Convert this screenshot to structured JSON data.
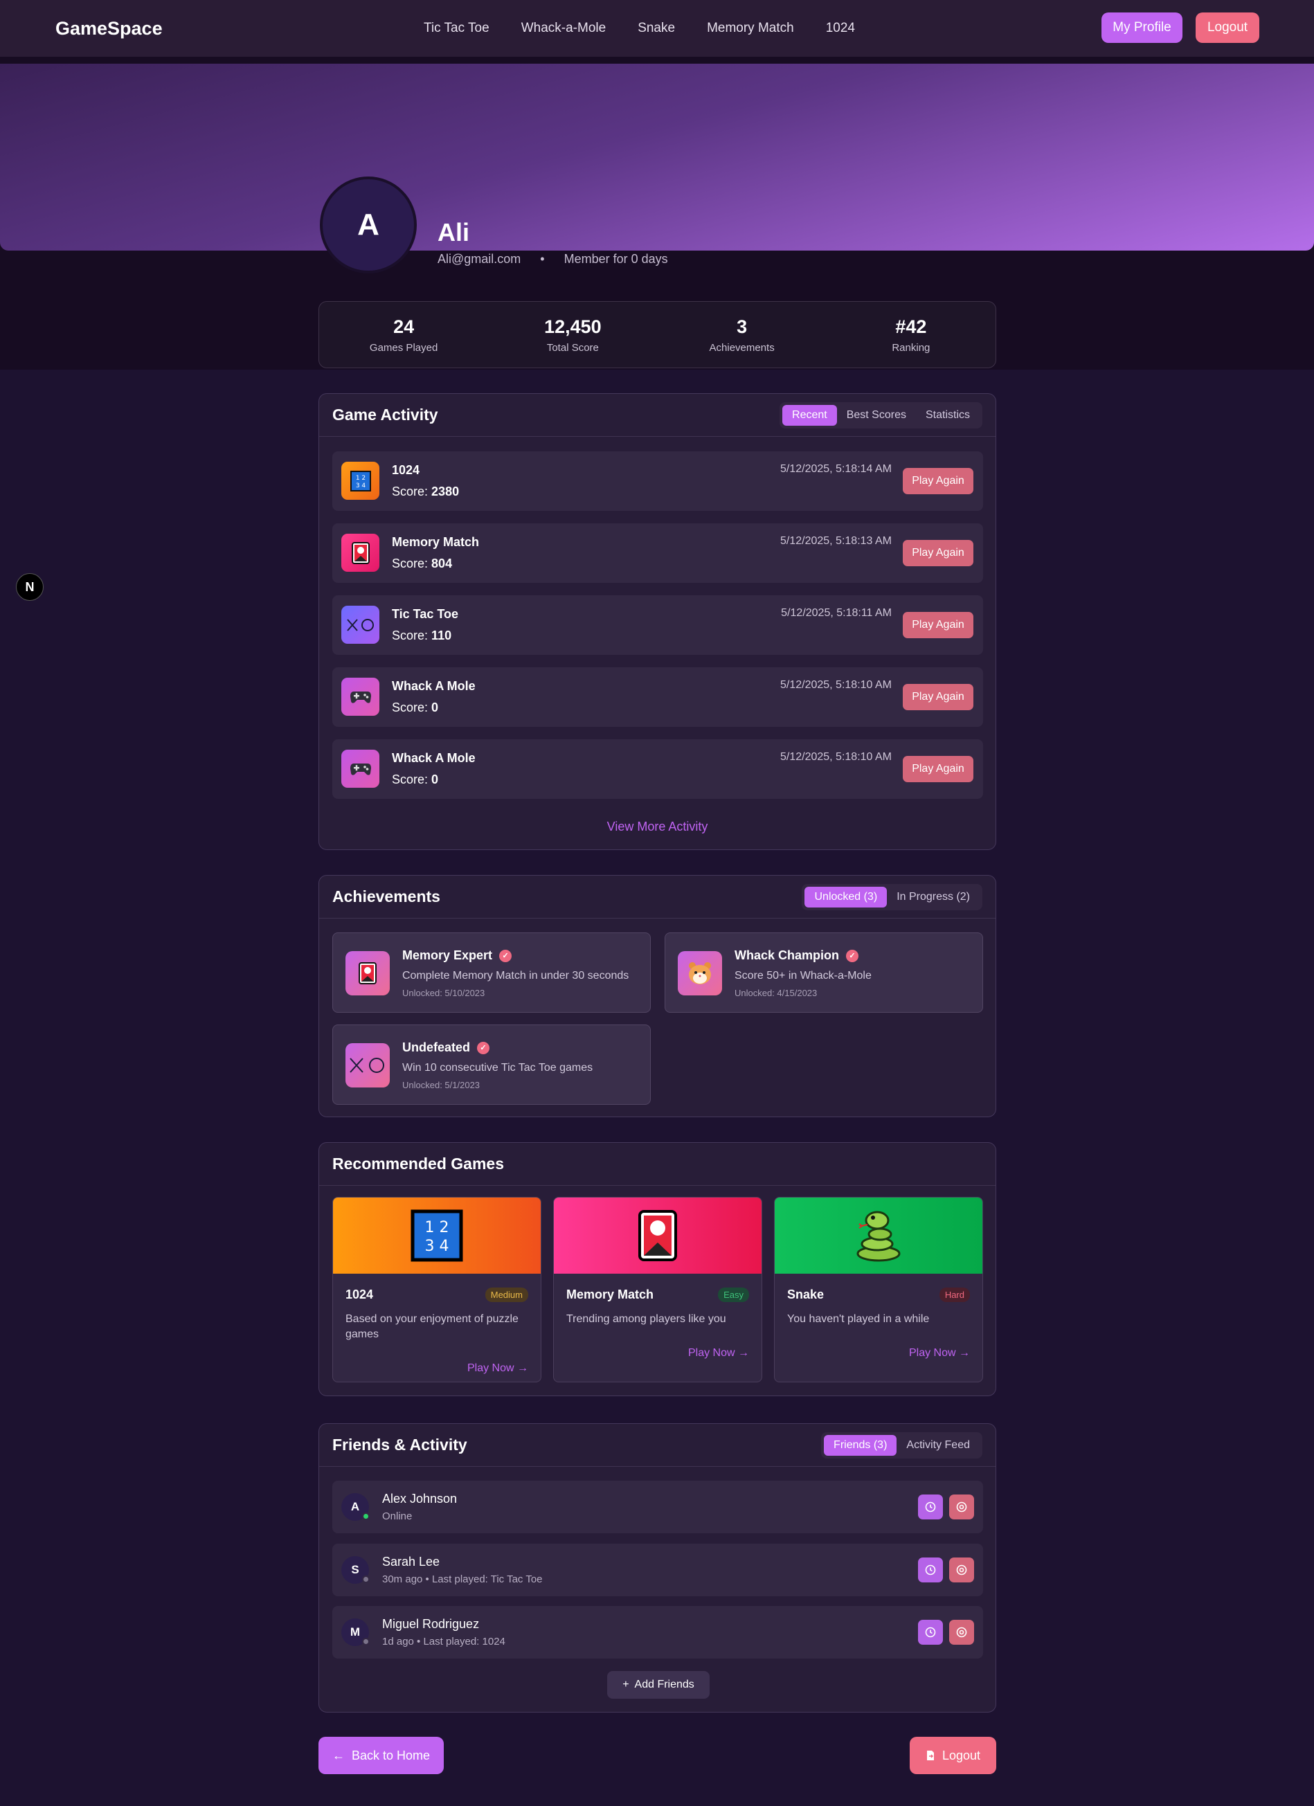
{
  "nav": {
    "logo": "GameSpace",
    "links": [
      "Tic Tac Toe",
      "Whack-a-Mole",
      "Snake",
      "Memory Match",
      "1024"
    ],
    "my_profile": "My Profile",
    "logout": "Logout"
  },
  "profile": {
    "avatar_letter": "A",
    "name": "Ali",
    "email": "Ali@gmail.com",
    "separator": "•",
    "member": "Member for 0 days"
  },
  "stats": [
    {
      "value": "24",
      "label": "Games Played"
    },
    {
      "value": "12,450",
      "label": "Total Score"
    },
    {
      "value": "3",
      "label": "Achievements"
    },
    {
      "value": "#42",
      "label": "Ranking"
    }
  ],
  "activity": {
    "title": "Game Activity",
    "tabs": [
      "Recent",
      "Best Scores",
      "Statistics"
    ],
    "score_label": "Score:",
    "play_again": "Play Again",
    "view_more": "View More Activity",
    "items": [
      {
        "game": "1024",
        "score": "2380",
        "time": "5/12/2025, 5:18:14 AM",
        "icon": "number-tiles-icon"
      },
      {
        "game": "Memory Match",
        "score": "804",
        "time": "5/12/2025, 5:18:13 AM",
        "icon": "card-icon"
      },
      {
        "game": "Tic Tac Toe",
        "score": "110",
        "time": "5/12/2025, 5:18:11 AM",
        "icon": "xo-icon"
      },
      {
        "game": "Whack A Mole",
        "score": "0",
        "time": "5/12/2025, 5:18:10 AM",
        "icon": "gamepad-icon"
      },
      {
        "game": "Whack A Mole",
        "score": "0",
        "time": "5/12/2025, 5:18:10 AM",
        "icon": "gamepad-icon"
      }
    ]
  },
  "achievements": {
    "title": "Achievements",
    "tabs": [
      "Unlocked (3)",
      "In Progress (2)"
    ],
    "items": [
      {
        "title": "Memory Expert",
        "desc": "Complete Memory Match in under 30 seconds",
        "unlocked": "Unlocked: 5/10/2023",
        "icon": "card-icon"
      },
      {
        "title": "Whack Champion",
        "desc": "Score 50+ in Whack-a-Mole",
        "unlocked": "Unlocked: 4/15/2023",
        "icon": "hamster-icon"
      },
      {
        "title": "Undefeated",
        "desc": "Win 10 consecutive Tic Tac Toe games",
        "unlocked": "Unlocked: 5/1/2023",
        "icon": "xo-icon"
      }
    ]
  },
  "recommended": {
    "title": "Recommended Games",
    "play_now": "Play Now",
    "items": [
      {
        "name": "1024",
        "badge": "Medium",
        "badge_color": "#e9b949",
        "desc": "Based on your enjoyment of puzzle games",
        "icon": "number-tiles-icon"
      },
      {
        "name": "Memory Match",
        "badge": "Easy",
        "badge_color": "#3ec27a",
        "desc": "Trending among players like you",
        "icon": "card-icon"
      },
      {
        "name": "Snake",
        "badge": "Hard",
        "badge_color": "#f0687f",
        "desc": "You haven't played in a while",
        "icon": "snake-icon"
      }
    ]
  },
  "friends": {
    "title": "Friends & Activity",
    "tabs": [
      "Friends (3)",
      "Activity Feed"
    ],
    "add": "Add Friends",
    "items": [
      {
        "initial": "A",
        "name": "Alex Johnson",
        "status": "Online",
        "online": true
      },
      {
        "initial": "S",
        "name": "Sarah Lee",
        "status": "30m ago • Last played: Tic Tac Toe",
        "online": false
      },
      {
        "initial": "M",
        "name": "Miguel Rodriguez",
        "status": "1d ago • Last played: 1024",
        "online": false
      }
    ]
  },
  "footer": {
    "back": "Back to Home",
    "logout": "Logout"
  },
  "dev_badge": "N",
  "colors": {
    "accent": "#c064f2",
    "danger": "#f06a82",
    "background": "#1d1230"
  }
}
